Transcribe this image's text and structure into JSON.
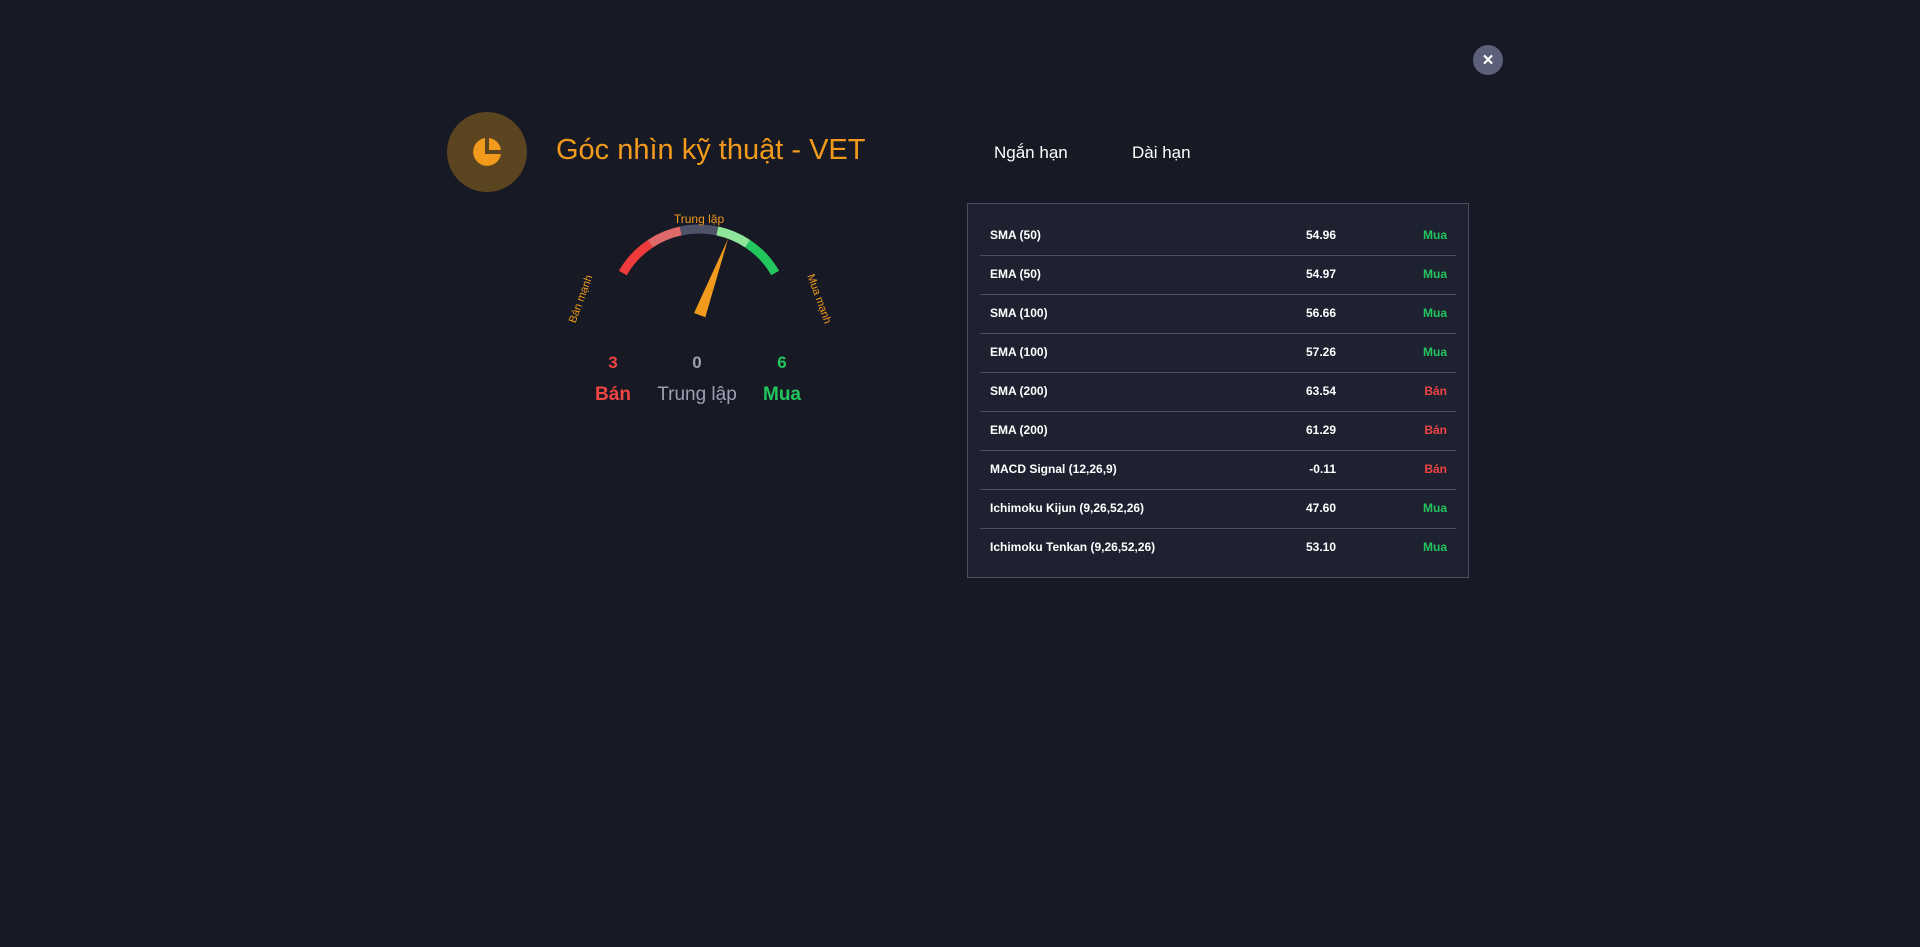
{
  "dialog": {
    "close_label": "×",
    "title": "Góc nhìn kỹ thuật - VET",
    "logo_icon": "pie-chart-icon",
    "accent_color": "#f29a1b"
  },
  "tabs": [
    {
      "label": "Ngắn hạn"
    },
    {
      "label": "Dài hạn"
    }
  ],
  "gauge": {
    "label_left": "Bán mạnh",
    "label_top": "Trung lập",
    "label_right": "Mua mạnh",
    "needle_position": 0.67,
    "colors": {
      "strong_sell": "#ef3b3b",
      "sell": "#e06a6a",
      "neutral": "#4f536a",
      "buy": "#8fe59a",
      "strong_buy": "#22c55e",
      "needle": "#f29a1b"
    }
  },
  "summary": {
    "sell_count": "3",
    "sell_label": "Bán",
    "neutral_count": "0",
    "neutral_label": "Trung lập",
    "buy_count": "6",
    "buy_label": "Mua"
  },
  "indicators": [
    {
      "name": "SMA (50)",
      "value": "54.96",
      "signal": "Mua",
      "signal_color": "#22c55e"
    },
    {
      "name": "EMA (50)",
      "value": "54.97",
      "signal": "Mua",
      "signal_color": "#22c55e"
    },
    {
      "name": "SMA (100)",
      "value": "56.66",
      "signal": "Mua",
      "signal_color": "#22c55e"
    },
    {
      "name": "EMA (100)",
      "value": "57.26",
      "signal": "Mua",
      "signal_color": "#22c55e"
    },
    {
      "name": "SMA (200)",
      "value": "63.54",
      "signal": "Bán",
      "signal_color": "#ef4444"
    },
    {
      "name": "EMA (200)",
      "value": "61.29",
      "signal": "Bán",
      "signal_color": "#ef4444"
    },
    {
      "name": "MACD Signal (12,26,9)",
      "value": "-0.11",
      "signal": "Bán",
      "signal_color": "#ef4444"
    },
    {
      "name": "Ichimoku Kijun (9,26,52,26)",
      "value": "47.60",
      "signal": "Mua",
      "signal_color": "#22c55e"
    },
    {
      "name": "Ichimoku Tenkan (9,26,52,26)",
      "value": "53.10",
      "signal": "Mua",
      "signal_color": "#22c55e"
    }
  ]
}
